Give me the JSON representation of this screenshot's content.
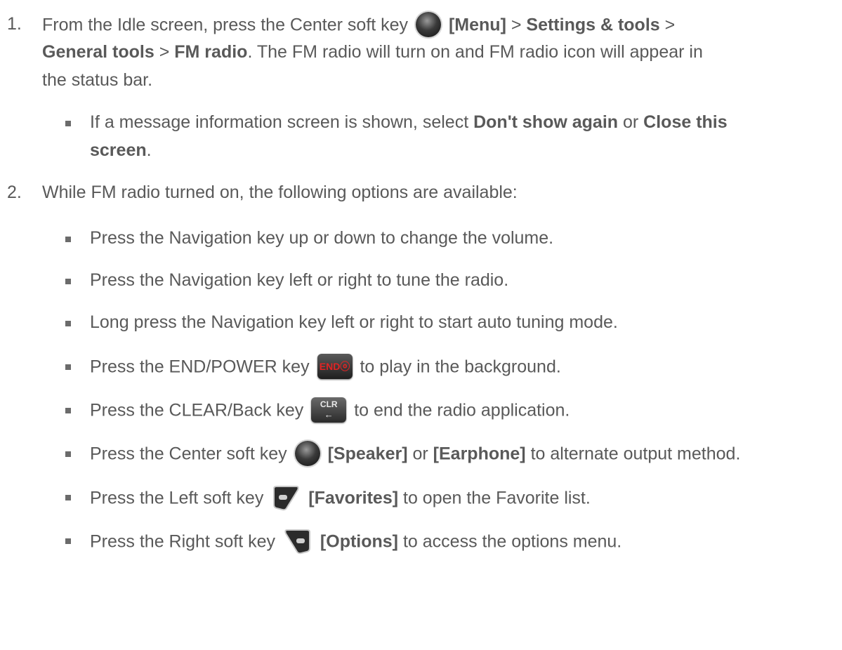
{
  "step1": {
    "number": "1.",
    "l1_a": "From the Idle screen, press the Center soft key",
    "l1_b": "[Menu]",
    "l1_c": " > ",
    "l1_d": "Settings & tools",
    "l1_e": " >",
    "l2_a": "General tools",
    "l2_b": " > ",
    "l2_c": "FM radio",
    "l2_d": ". The FM radio will turn on and FM radio icon will appear in",
    "l3": "the status bar.",
    "sub1_a": "If a message information screen is shown, select ",
    "sub1_b": "Don't show again",
    "sub1_c": " or ",
    "sub1_d": "Close this",
    "sub1_e": "screen",
    "sub1_f": "."
  },
  "step2": {
    "number": "2.",
    "intro": "While FM radio turned on, the following options are available:",
    "b1": "Press the Navigation key up or down to change the volume.",
    "b2": "Press the Navigation key left or right to tune the radio.",
    "b3": "Long press the Navigation key left or right to start auto tuning mode.",
    "b4_a": "Press the END/POWER key",
    "b4_b": "to play in the background.",
    "b5_a": "Press the CLEAR/Back key",
    "b5_b": "to end the radio application.",
    "b6_a": "Press the Center soft key",
    "b6_b": "[Speaker]",
    "b6_c": " or ",
    "b6_d": "[Earphone]",
    "b6_e": " to alternate output method.",
    "b7_a": "Press the Left soft key",
    "b7_b": "[Favorites]",
    "b7_c": " to open the Favorite list.",
    "b8_a": "Press the Right soft key",
    "b8_b": "[Options]",
    "b8_c": " to access the options menu."
  },
  "keys": {
    "end_key": "ENDⓞ",
    "clr_key": "CLR",
    "clr_arrow": "←"
  }
}
